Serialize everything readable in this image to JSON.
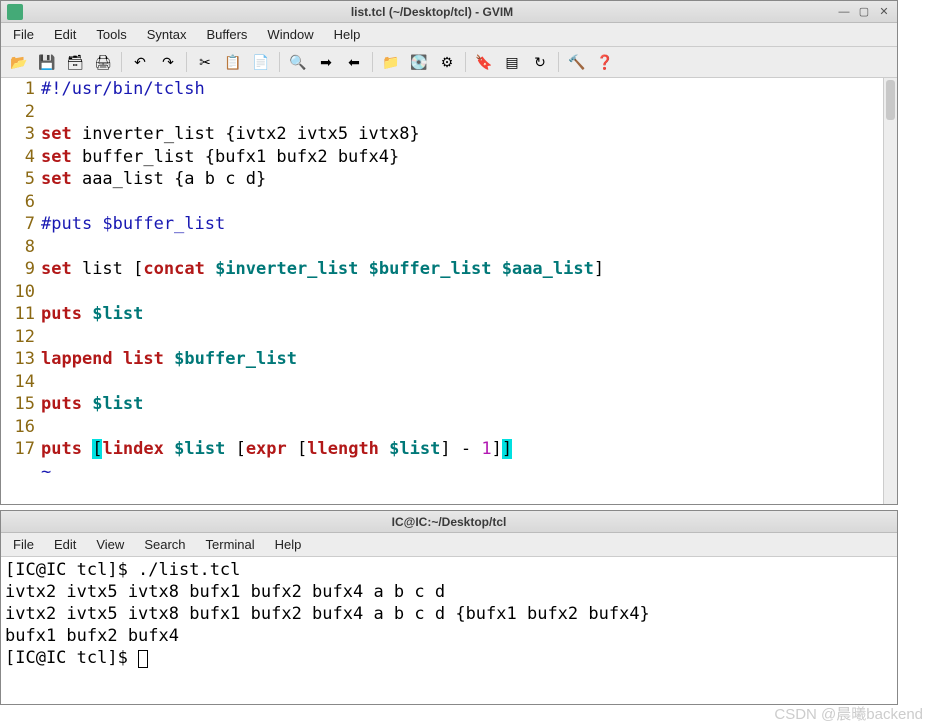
{
  "gvim": {
    "title": "list.tcl (~/Desktop/tcl) - GVIM",
    "menu": [
      "File",
      "Edit",
      "Tools",
      "Syntax",
      "Buffers",
      "Window",
      "Help"
    ],
    "toolbar_icons": [
      "open",
      "save",
      "saveall",
      "print",
      "|",
      "undo",
      "redo",
      "|",
      "cut",
      "copy",
      "paste",
      "|",
      "find",
      "next",
      "prev",
      "|",
      "load",
      "session",
      "make",
      "|",
      "tag",
      "shell",
      "run",
      "|",
      "build",
      "help"
    ],
    "lines": [
      {
        "n": 1,
        "tokens": [
          {
            "t": "#!/usr/bin/tclsh",
            "c": "cmt"
          }
        ]
      },
      {
        "n": 2,
        "tokens": []
      },
      {
        "n": 3,
        "tokens": [
          {
            "t": "set",
            "c": "kw-red"
          },
          {
            "t": " inverter_list {ivtx2 ivtx5 ivtx8}",
            "c": ""
          }
        ]
      },
      {
        "n": 4,
        "tokens": [
          {
            "t": "set",
            "c": "kw-red"
          },
          {
            "t": " buffer_list {bufx1 bufx2 bufx4}",
            "c": ""
          }
        ]
      },
      {
        "n": 5,
        "tokens": [
          {
            "t": "set",
            "c": "kw-red"
          },
          {
            "t": " aaa_list {a b c d}",
            "c": ""
          }
        ]
      },
      {
        "n": 6,
        "tokens": []
      },
      {
        "n": 7,
        "tokens": [
          {
            "t": "#puts $buffer_list",
            "c": "cmt"
          }
        ]
      },
      {
        "n": 8,
        "tokens": []
      },
      {
        "n": 9,
        "tokens": [
          {
            "t": "set",
            "c": "kw-red"
          },
          {
            "t": " list ",
            "c": ""
          },
          {
            "t": "[",
            "c": ""
          },
          {
            "t": "concat",
            "c": "kw-red"
          },
          {
            "t": " ",
            "c": ""
          },
          {
            "t": "$inverter_list",
            "c": "kw-teal"
          },
          {
            "t": " ",
            "c": ""
          },
          {
            "t": "$buffer_list",
            "c": "kw-teal"
          },
          {
            "t": " ",
            "c": ""
          },
          {
            "t": "$aaa_list",
            "c": "kw-teal"
          },
          {
            "t": "]",
            "c": ""
          }
        ]
      },
      {
        "n": 10,
        "tokens": []
      },
      {
        "n": 11,
        "tokens": [
          {
            "t": "puts",
            "c": "kw-red"
          },
          {
            "t": " ",
            "c": ""
          },
          {
            "t": "$list",
            "c": "kw-teal"
          }
        ]
      },
      {
        "n": 12,
        "tokens": []
      },
      {
        "n": 13,
        "tokens": [
          {
            "t": "lappend",
            "c": "kw-red"
          },
          {
            "t": " ",
            "c": ""
          },
          {
            "t": "list",
            "c": "kw-red"
          },
          {
            "t": " ",
            "c": ""
          },
          {
            "t": "$buffer_list",
            "c": "kw-teal"
          }
        ]
      },
      {
        "n": 14,
        "tokens": []
      },
      {
        "n": 15,
        "tokens": [
          {
            "t": "puts",
            "c": "kw-red"
          },
          {
            "t": " ",
            "c": ""
          },
          {
            "t": "$list",
            "c": "kw-teal"
          }
        ]
      },
      {
        "n": 16,
        "tokens": []
      },
      {
        "n": 17,
        "tokens": [
          {
            "t": "puts",
            "c": "kw-red"
          },
          {
            "t": " ",
            "c": ""
          },
          {
            "t": "[",
            "c": "hl-bracket"
          },
          {
            "t": "lindex",
            "c": "kw-red"
          },
          {
            "t": " ",
            "c": ""
          },
          {
            "t": "$list",
            "c": "kw-teal"
          },
          {
            "t": " ",
            "c": ""
          },
          {
            "t": "[",
            "c": ""
          },
          {
            "t": "expr",
            "c": "kw-red"
          },
          {
            "t": " ",
            "c": ""
          },
          {
            "t": "[",
            "c": ""
          },
          {
            "t": "llength",
            "c": "kw-red"
          },
          {
            "t": " ",
            "c": ""
          },
          {
            "t": "$list",
            "c": "kw-teal"
          },
          {
            "t": "]",
            "c": ""
          },
          {
            "t": " - ",
            "c": ""
          },
          {
            "t": "1",
            "c": "kw-mag"
          },
          {
            "t": "]",
            "c": ""
          },
          {
            "t": "]",
            "c": "hl-bracket"
          }
        ]
      }
    ],
    "tilde": "~"
  },
  "terminal": {
    "title": "IC@IC:~/Desktop/tcl",
    "menu": [
      "File",
      "Edit",
      "View",
      "Search",
      "Terminal",
      "Help"
    ],
    "lines": [
      "[IC@IC tcl]$ ./list.tcl",
      "ivtx2 ivtx5 ivtx8 bufx1 bufx2 bufx4 a b c d",
      "ivtx2 ivtx5 ivtx8 bufx1 bufx2 bufx4 a b c d {bufx1 bufx2 bufx4}",
      "bufx1 bufx2 bufx4",
      "[IC@IC tcl]$ "
    ]
  },
  "watermark": "CSDN @晨曦backend"
}
